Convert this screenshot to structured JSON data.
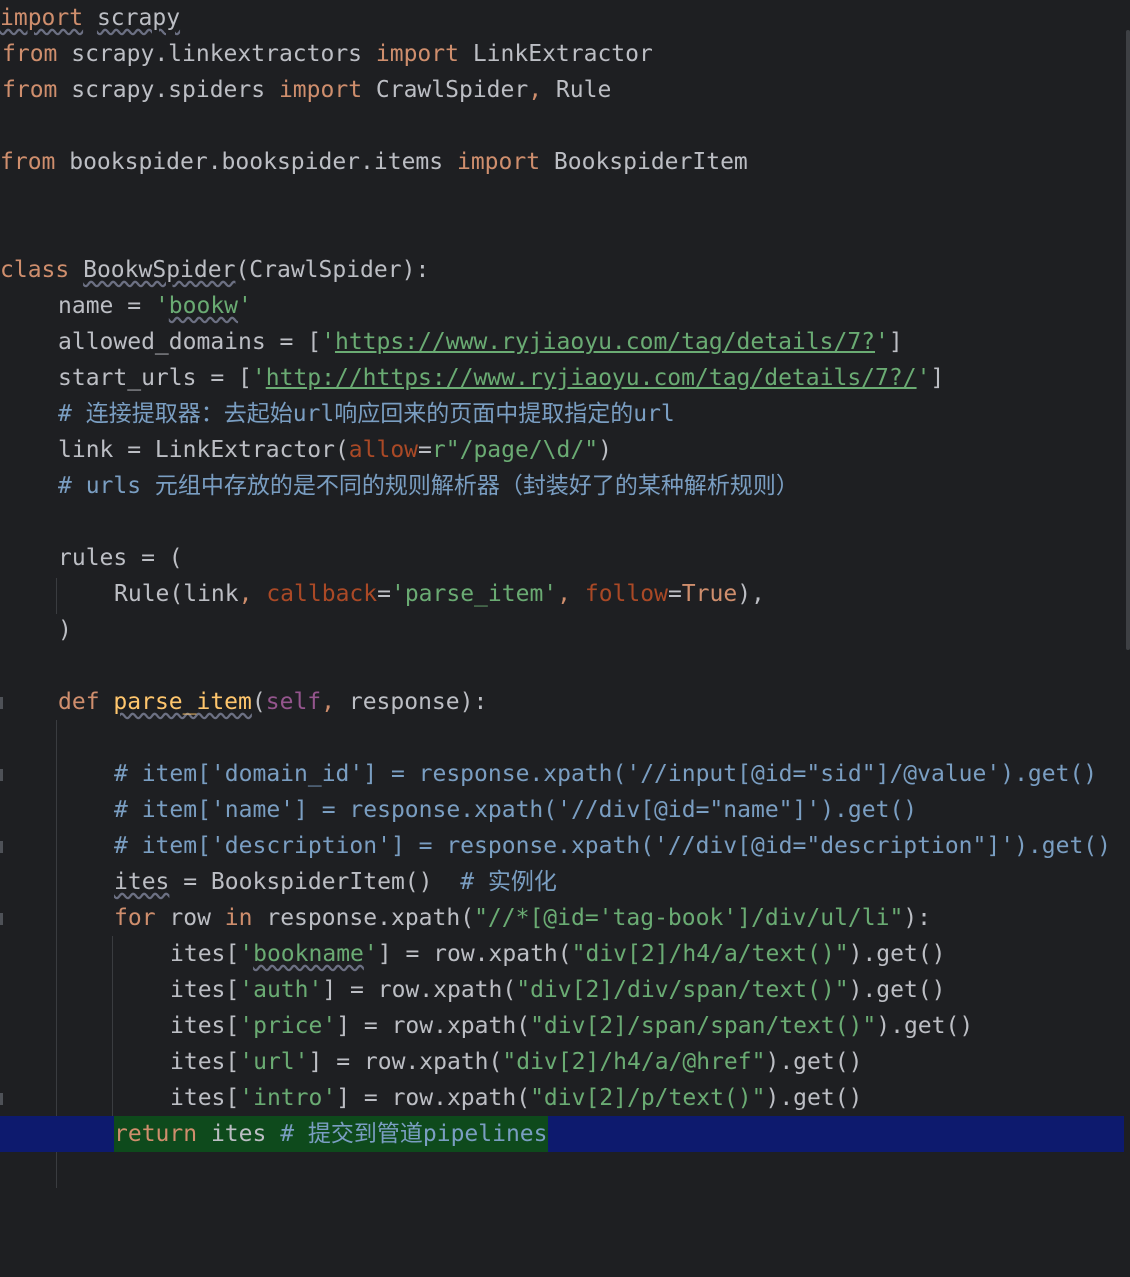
{
  "editor": {
    "language": "python",
    "colors": {
      "background": "#1e1f22",
      "keyword": "#cf8e6d",
      "string": "#6aab73",
      "comment": "#7a9ec2",
      "current_line": "#0d1a6e",
      "selection": "#0e4a1c"
    },
    "lines": [
      {
        "t1": "import",
        "t2": " ",
        "t3": "scrapy"
      },
      {
        "t1": "from",
        "t2": " scrapy.linkextractors ",
        "t3": "import",
        "t4": " LinkExtractor"
      },
      {
        "t1": "from",
        "t2": " scrapy.spiders ",
        "t3": "import",
        "t4": " CrawlSpider",
        "t5": ",",
        "t6": " Rule"
      },
      {},
      {
        "t1": "from",
        "t2": " bookspider.bookspider.items ",
        "t3": "import",
        "t4": " BookspiderItem"
      },
      {},
      {},
      {
        "t1": "class",
        "t2": " ",
        "t3": "BookwSpider",
        "t4": "(CrawlSpider):"
      },
      {
        "t1": "name = ",
        "t2": "'",
        "t3": "bookw",
        "t4": "'"
      },
      {
        "t1": "allowed_domains = [",
        "t2": "'",
        "t3": "https://www.ryjiaoyu.com/tag/details/7?",
        "t4": "'",
        "t5": "]"
      },
      {
        "t1": "start_urls = [",
        "t2": "'",
        "t3": "http://https://www.ryjiaoyu.com/tag/details/7?/",
        "t4": "'",
        "t5": "]"
      },
      {
        "t1": "# 连接提取器：去起始url响应回来的页面中提取指定的url"
      },
      {
        "t1": "link = LinkExtractor(",
        "t2": "allow",
        "t3": "=",
        "t4": "r\"/page/\\d/\"",
        "t5": ")"
      },
      {
        "t1": "# urls 元组中存放的是不同的规则解析器（封装好了的某种解析规则）"
      },
      {},
      {
        "t1": "rules = ("
      },
      {
        "t1": "Rule(link",
        "t2": ", ",
        "t3": "callback",
        "t4": "=",
        "t5": "'parse_item'",
        "t6": ", ",
        "t7": "follow",
        "t8": "=",
        "t9": "True",
        "t10": "),"
      },
      {
        "t1": ")"
      },
      {},
      {
        "t1": "def",
        "t2": " ",
        "t3": "parse_item",
        "t4": "(",
        "t5": "self",
        "t6": ", ",
        "t7": "response):"
      },
      {},
      {
        "t1": "# item['domain_id'] = response.xpath('//input[@id=\"sid\"]/@value').get()"
      },
      {
        "t1": "# item['name'] = response.xpath('//div[@id=\"name\"]').get()"
      },
      {
        "t1": "# item['description'] = response.xpath('//div[@id=\"description\"]').get()"
      },
      {
        "t1": "ites",
        "t2": " = BookspiderItem()  ",
        "t3": "# 实例化"
      },
      {
        "t1": "for",
        "t2": " row ",
        "t3": "in",
        "t4": " response.xpath(",
        "t5": "\"//*[@id='tag-book']/div/ul/li\"",
        "t6": "):"
      },
      {
        "t1": "ites[",
        "t2": "'",
        "t3": "bookname",
        "t4": "'",
        "t5": "] = row.xpath(",
        "t6": "\"div[2]/h4/a/text()\"",
        "t7": ").get()"
      },
      {
        "t1": "ites[",
        "t2": "'auth'",
        "t3": "] = row.xpath(",
        "t4": "\"div[2]/div/span/text()\"",
        "t5": ").get()"
      },
      {
        "t1": "ites[",
        "t2": "'price'",
        "t3": "] = row.xpath(",
        "t4": "\"div[2]/span/span/text()\"",
        "t5": ").get()"
      },
      {
        "t1": "ites[",
        "t2": "'url'",
        "t3": "] = row.xpath(",
        "t4": "\"div[2]/h4/a/@href\"",
        "t5": ").get()"
      },
      {
        "t1": "ites[",
        "t2": "'intro'",
        "t3": "] = row.xpath(",
        "t4": "\"div[2]/p/text()\"",
        "t5": ").get()"
      },
      {
        "t1": "return",
        "t2": " ites ",
        "t3": "# 提交到管道pipelines"
      }
    ]
  }
}
